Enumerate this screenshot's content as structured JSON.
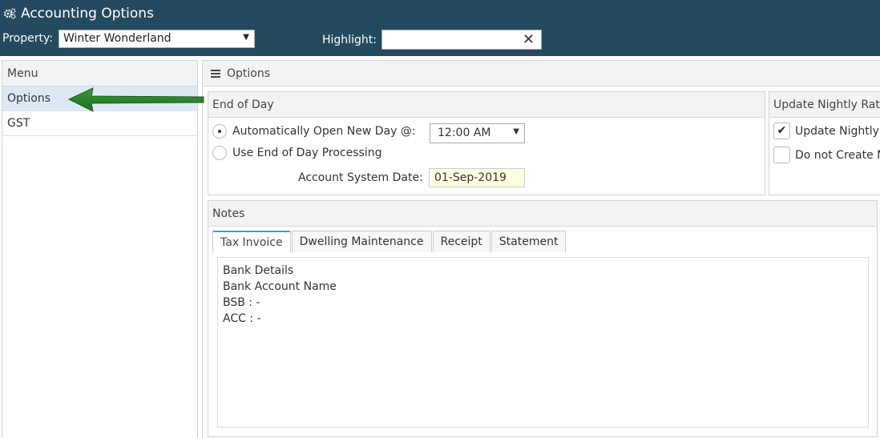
{
  "header": {
    "title": "Accounting Options",
    "property_label": "Property:",
    "property_value": "Winter Wonderland",
    "highlight_label": "Highlight:",
    "highlight_value": ""
  },
  "menu": {
    "title": "Menu",
    "items": [
      {
        "label": "Options"
      },
      {
        "label": "GST"
      }
    ]
  },
  "main": {
    "title": "Options"
  },
  "end_of_day": {
    "title": "End of Day",
    "auto_open_label": "Automatically Open New Day @:",
    "auto_open_time": "12:00 AM",
    "eod_processing_label": "Use End of Day Processing",
    "system_date_label": "Account System Date:",
    "system_date_value": "01-Sep-2019"
  },
  "nightly": {
    "title": "Update Nightly Rat",
    "update_label": "Update Nightly",
    "do_not_create_label": "Do not Create N"
  },
  "notes": {
    "title": "Notes",
    "tabs": [
      {
        "label": "Tax Invoice"
      },
      {
        "label": "Dwelling Maintenance"
      },
      {
        "label": "Receipt"
      },
      {
        "label": "Statement"
      }
    ],
    "lines": [
      "Bank Details",
      "Bank Account Name",
      "BSB : -",
      "ACC : -"
    ]
  },
  "colors": {
    "header_bg": "#234a5f",
    "active_menu": "#dce9f5",
    "arrow": "#2e8b2e",
    "tab_accent": "#3aa3b7",
    "date_bg": "#ffffe0"
  }
}
